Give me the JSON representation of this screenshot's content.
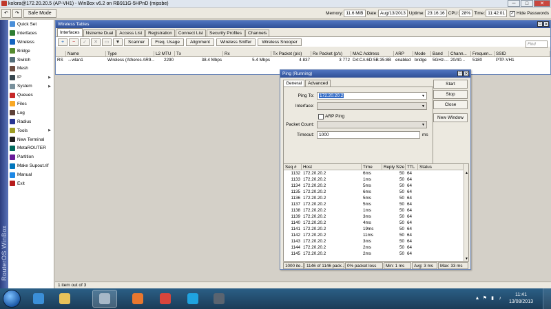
{
  "window": {
    "title": "kolora@172.20.20.5 (AP-VH1) - WinBox v6.2 on RB911G-5HPnD (mipsbe)",
    "controls": {
      "minimize": "─",
      "maximize": "□",
      "close": "✕"
    }
  },
  "toolbar": {
    "undo": "↶",
    "redo": "↷",
    "safe_mode": "Safe Mode",
    "memory_label": "Memory:",
    "memory_value": "11.6 MiB",
    "date_label": "Date:",
    "date_value": "Aug/13/2013",
    "uptime_label": "Uptime:",
    "uptime_value": "23:16:16",
    "cpu_label": "CPU:",
    "cpu_value": "28%",
    "time_label": "Time:",
    "time_value": "11:42:01",
    "hide_passwords_label": "Hide Passwords",
    "hide_passwords_checked": "✓"
  },
  "brand_strip": {
    "text": "RouterOS WinBox"
  },
  "menu": {
    "items": [
      {
        "label": "Quick Set",
        "icon": "quickset-icon",
        "color": "#4a8fd9",
        "arrow": ""
      },
      {
        "label": "Interfaces",
        "icon": "interfaces-icon",
        "color": "#2e7d32",
        "arrow": ""
      },
      {
        "label": "Wireless",
        "icon": "wireless-icon",
        "color": "#1565c0",
        "arrow": ""
      },
      {
        "label": "Bridge",
        "icon": "bridge-icon",
        "color": "#558b2f",
        "arrow": ""
      },
      {
        "label": "Switch",
        "icon": "switch-icon",
        "color": "#546e7a",
        "arrow": ""
      },
      {
        "label": "Mesh",
        "icon": "mesh-icon",
        "color": "#6d4c41",
        "arrow": ""
      },
      {
        "label": "IP",
        "icon": "ip-icon",
        "color": "#37474f",
        "arrow": "▶"
      },
      {
        "label": "System",
        "icon": "system-icon",
        "color": "#78909c",
        "arrow": "▶"
      },
      {
        "label": "Queues",
        "icon": "queues-icon",
        "color": "#c62828",
        "arrow": ""
      },
      {
        "label": "Files",
        "icon": "files-icon",
        "color": "#f9a825",
        "arrow": ""
      },
      {
        "label": "Log",
        "icon": "log-icon",
        "color": "#5d4037",
        "arrow": ""
      },
      {
        "label": "Radius",
        "icon": "radius-icon",
        "color": "#283593",
        "arrow": ""
      },
      {
        "label": "Tools",
        "icon": "tools-icon",
        "color": "#9e9d24",
        "arrow": "▶"
      },
      {
        "label": "New Terminal",
        "icon": "terminal-icon",
        "color": "#212121",
        "arrow": ""
      },
      {
        "label": "MetaROUTER",
        "icon": "metarouter-icon",
        "color": "#00695c",
        "arrow": ""
      },
      {
        "label": "Partition",
        "icon": "partition-icon",
        "color": "#6a1b9a",
        "arrow": ""
      },
      {
        "label": "Make Supout.rif",
        "icon": "supout-icon",
        "color": "#0277bd",
        "arrow": ""
      },
      {
        "label": "Manual",
        "icon": "manual-icon",
        "color": "#1e88e5",
        "arrow": ""
      },
      {
        "label": "Exit",
        "icon": "exit-icon",
        "color": "#b71c1c",
        "arrow": ""
      }
    ]
  },
  "wireless_tables": {
    "title": "Wireless Tables",
    "controls": {
      "maximize": "□",
      "close": "✕"
    },
    "tabs": [
      "Interfaces",
      "Nstreme Dual",
      "Access List",
      "Registration",
      "Connect List",
      "Security Profiles",
      "Channels"
    ],
    "icon_buttons": [
      "+",
      "−",
      "✓",
      "✕",
      "▭",
      "▼"
    ],
    "buttons": [
      "Scanner",
      "Freq. Usage",
      "Alignment",
      "Wireless Sniffer",
      "Wireless Snooper"
    ],
    "find_placeholder": "Find",
    "columns": [
      "",
      "Name",
      "Type",
      "L2 MTU",
      "Tx",
      "Rx",
      "Tx Packet (p/s)",
      "Rx Packet (p/s)",
      "MAC Address",
      "ARP",
      "Mode",
      "Band",
      "Chann...",
      "Frequen...",
      "SSID"
    ],
    "rows": [
      [
        "RS",
        "↔wlan1",
        "Wireless (Atheros AR9...",
        "2290",
        "38.4 Mbps",
        "5.4 Mbps",
        "4 837",
        "3 772",
        "D4:CA:6D:5B:35:8B",
        "enabled",
        "bridge",
        "5GHz-...",
        "20/40...",
        "5180",
        "PTP-VH1"
      ]
    ],
    "status": "1 item out of 3"
  },
  "ping": {
    "title": "Ping (Running)",
    "controls": {
      "maximize": "□",
      "close": "✕"
    },
    "tabs": [
      "General",
      "Advanced"
    ],
    "ping_to_label": "Ping To:",
    "ping_to_value": "172.20.20.2",
    "interface_label": "Interface:",
    "interface_value": "",
    "arp_ping_label": "ARP Ping",
    "packet_count_label": "Packet Count:",
    "packet_count_value": "",
    "timeout_label": "Timeout:",
    "timeout_value": "1000",
    "timeout_unit": "ms",
    "buttons": {
      "start": "Start",
      "stop": "Stop",
      "close": "Close",
      "new_window": "New Window"
    },
    "columns": [
      "Seq #",
      "Host",
      "Time",
      "Reply Size",
      "TTL",
      "Status"
    ],
    "rows": [
      [
        "1132",
        "172.20.20.2",
        "6ms",
        "50",
        "64",
        ""
      ],
      [
        "1133",
        "172.20.20.2",
        "1ms",
        "50",
        "64",
        ""
      ],
      [
        "1134",
        "172.20.20.2",
        "5ms",
        "50",
        "64",
        ""
      ],
      [
        "1135",
        "172.20.20.2",
        "6ms",
        "50",
        "64",
        ""
      ],
      [
        "1136",
        "172.20.20.2",
        "5ms",
        "50",
        "64",
        ""
      ],
      [
        "1137",
        "172.20.20.2",
        "5ms",
        "50",
        "64",
        ""
      ],
      [
        "1138",
        "172.20.20.2",
        "1ms",
        "50",
        "64",
        ""
      ],
      [
        "1139",
        "172.20.20.2",
        "3ms",
        "50",
        "64",
        ""
      ],
      [
        "1140",
        "172.20.20.2",
        "4ms",
        "50",
        "64",
        ""
      ],
      [
        "1141",
        "172.20.20.2",
        "19ms",
        "50",
        "64",
        ""
      ],
      [
        "1142",
        "172.20.20.2",
        "11ms",
        "50",
        "64",
        ""
      ],
      [
        "1143",
        "172.20.20.2",
        "3ms",
        "50",
        "64",
        ""
      ],
      [
        "1144",
        "172.20.20.2",
        "2ms",
        "50",
        "64",
        ""
      ],
      [
        "1145",
        "172.20.20.2",
        "2ms",
        "50",
        "64",
        ""
      ]
    ],
    "status": [
      "1000 ite...",
      "1146 of 1146 pack...",
      "0% packet loss",
      "Min: 1 ms",
      "Avg: 3 ms",
      "Max: 33 ms"
    ]
  },
  "taskbar": {
    "apps": [
      {
        "name": "internet-explorer-icon",
        "color": "#3b8fd8",
        "active": false
      },
      {
        "name": "file-explorer-icon",
        "color": "#e8c25a",
        "active": false
      },
      {
        "name": "winbox-icon",
        "color": "#a7b8c8",
        "active": true
      },
      {
        "name": "firefox-icon",
        "color": "#e8772e",
        "active": false
      },
      {
        "name": "chrome-icon",
        "color": "#d9453c",
        "active": false
      },
      {
        "name": "skype-icon",
        "color": "#1fa3e0",
        "active": false
      },
      {
        "name": "terminal-app-icon",
        "color": "#5a6470",
        "active": false
      }
    ],
    "tray": [
      "▲",
      "⚑",
      "▮",
      "♪"
    ],
    "clock_time": "11:41",
    "clock_date": "13/08/2013"
  }
}
